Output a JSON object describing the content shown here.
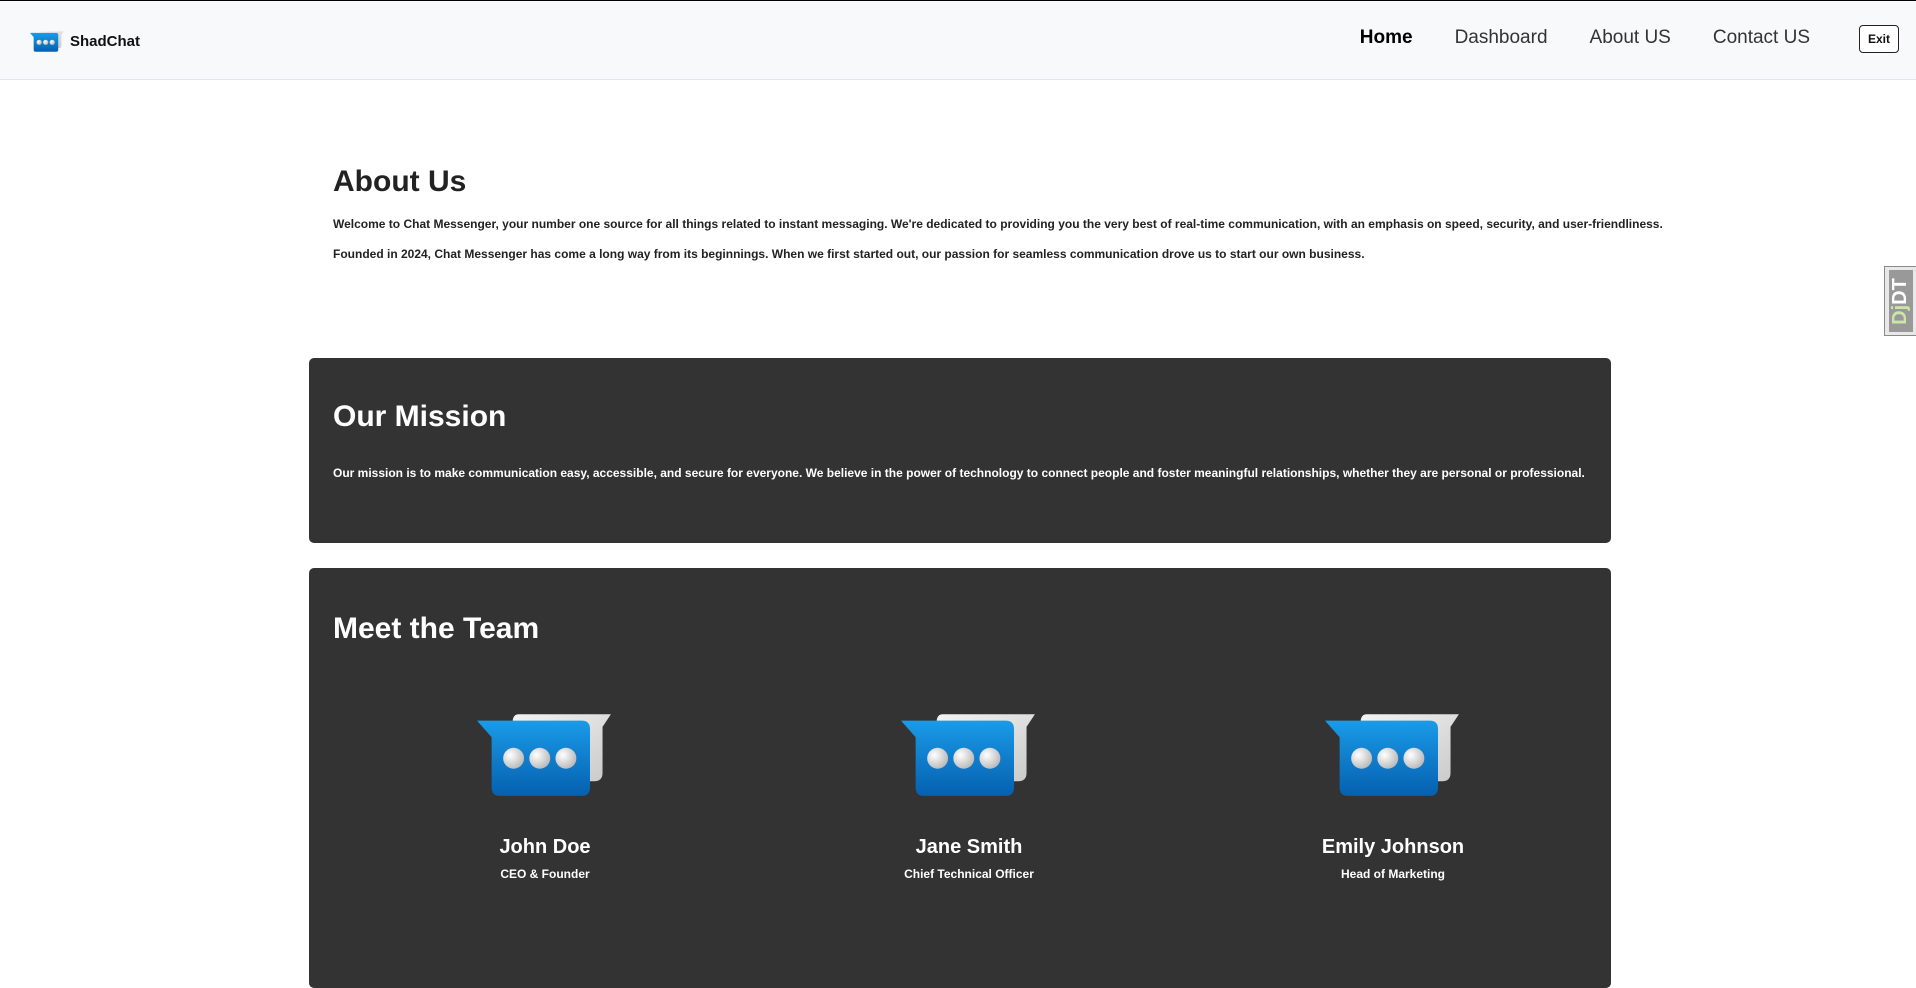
{
  "brand": {
    "name": "ShadChat",
    "logo_icon": "chat-bubbles-icon"
  },
  "nav": {
    "links": [
      {
        "label": "Home",
        "active": true
      },
      {
        "label": "Dashboard",
        "active": false
      },
      {
        "label": "About US",
        "active": false
      },
      {
        "label": "Contact US",
        "active": false
      }
    ],
    "exit_label": "Exit"
  },
  "about": {
    "title": "About Us",
    "paragraphs": [
      "Welcome to Chat Messenger, your number one source for all things related to instant messaging. We're dedicated to providing you the very best of real-time communication, with an emphasis on speed, security, and user-friendliness.",
      "Founded in 2024, Chat Messenger has come a long way from its beginnings. When we first started out, our passion for seamless communication drove us to start our own business."
    ]
  },
  "mission": {
    "title": "Our Mission",
    "text": "Our mission is to make communication easy, accessible, and secure for everyone. We believe in the power of technology to connect people and foster meaningful relationships, whether they are personal or professional."
  },
  "team": {
    "title": "Meet the Team",
    "members": [
      {
        "name": "John Doe",
        "role": "CEO & Founder",
        "avatar_icon": "chat-bubbles-icon"
      },
      {
        "name": "Jane Smith",
        "role": "Chief Technical Officer",
        "avatar_icon": "chat-bubbles-icon"
      },
      {
        "name": "Emily Johnson",
        "role": "Head of Marketing",
        "avatar_icon": "chat-bubbles-icon"
      }
    ]
  },
  "debug_toolbar": {
    "label_prefix": "Dj",
    "label_suffix": "DT"
  },
  "colors": {
    "navbar_bg": "#f8f9fa",
    "card_bg": "#333333",
    "bubble_blue": "#0a7fd0",
    "bubble_gray": "#e6e6e6"
  }
}
